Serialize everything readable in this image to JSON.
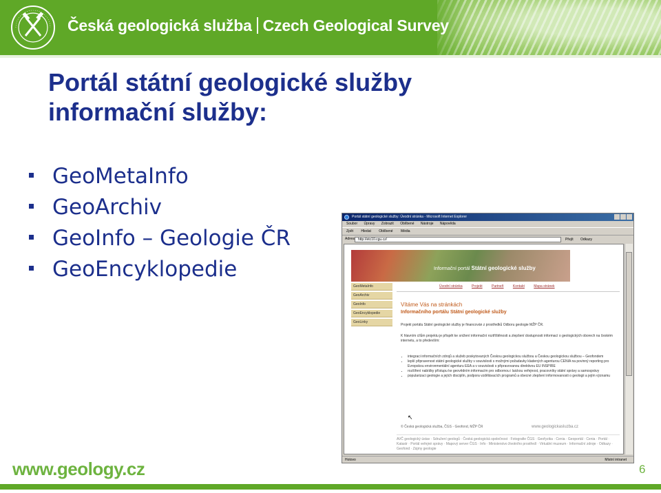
{
  "header": {
    "logo_text": "ČESKÁ GEOLOGICKÁ SLUŽBA 1919",
    "org_name_cz": "Česká geologická služba",
    "org_name_en": "Czech Geological Survey"
  },
  "title": {
    "line1": "Portál státní geologické služby",
    "line2": "informační služby:"
  },
  "bullets": [
    "GeoMetaInfo",
    "GeoArchiv",
    "GeoInfo – Geologie ČR",
    "GeoEncyklopedie"
  ],
  "browser": {
    "window_title": "Portál státní geologické služby: Úvodní stránka - Microsoft Internet Explorer",
    "menu": [
      "Soubor",
      "Úpravy",
      "Zobrazit",
      "Oblíbené",
      "Nástroje",
      "Nápověda"
    ],
    "toolbar": [
      "Zpět",
      "Hledat",
      "Oblíbené",
      "Média"
    ],
    "address_label": "Adresa",
    "address": "http://etc10.cgu.cz/",
    "go_label": "Přejít",
    "links_label": "Odkazy",
    "status": "Hotovo",
    "status_zone": "Místní intranet",
    "page": {
      "banner_text_prefix": "Informační portál",
      "banner_text_bold": "Státní geologické služby",
      "nav": [
        "GeoMetaInfo",
        "GeoArchiv",
        "GeoInfo",
        "GeoEncyklopedie",
        "GeoLinky"
      ],
      "top_links": [
        "Úvodní stránka",
        "Projekt",
        "Partneři",
        "Kontakt",
        "Mapa stránek"
      ],
      "welcome": "Vítáme Vás na stránkách",
      "welcome_sub": "Informačního portálu Státní geologické služby",
      "para1": "Projekt portálu Státní geologické služby je financován z prostředků Odboru geologie MŽP ČR.",
      "para2": "K hlavním cílům projektu je přispět ke snížení informační roztříštěnosti a zlepšení dostupnosti informací o geologických oborech na českém internetu, a to především:",
      "list": [
        "integraci informačních zdrojů a služeb poskytovaných Českou geologickou službou a Českou geologickou službou – Geofondem",
        "lepší připravenost státní geologické služby v souvislosti s možnými požadavky kladených agenturou CENIA na povinný reporting pro Evropskou environmentální agenturu EEA a v souvislosti s připravovanou direktivou EU INSPIRE",
        "rozšíření nabídky přístupu ke geovědním informacím pro odbornou i laickou veřejnost, pracovníky státní správy a samosprávy",
        "popularizaci geologie a jejích disciplín, podpora vzdělávacích programů a obecné zlepšení informovanosti o geologii a jejím významu"
      ],
      "footer_copyright": "© Česká geologická služba, ČGS - Geofond, MŽP ČR",
      "footer_web": "www.geologickasluzba.cz",
      "footer_links": "AVČ geologický ústav · Sdružení geologů · Česká geologická společnost · Fotografie ČGS · Geofyzika · Cenia · Geoportál · Cenia · Portál · Katastr · Portál veřejné správy · Mapový server ČGS · Info · Ministerstvo životního prostředí · Virtuální muzeum · Informační zdroje · Odkazy · Geofond · Zájmy geologie"
    }
  },
  "footer": {
    "url": "www.geology.cz",
    "page_number": "6"
  },
  "colors": {
    "brand_green": "#5fa827",
    "url_green": "#6db33f",
    "title_blue": "#1c2f8c"
  }
}
